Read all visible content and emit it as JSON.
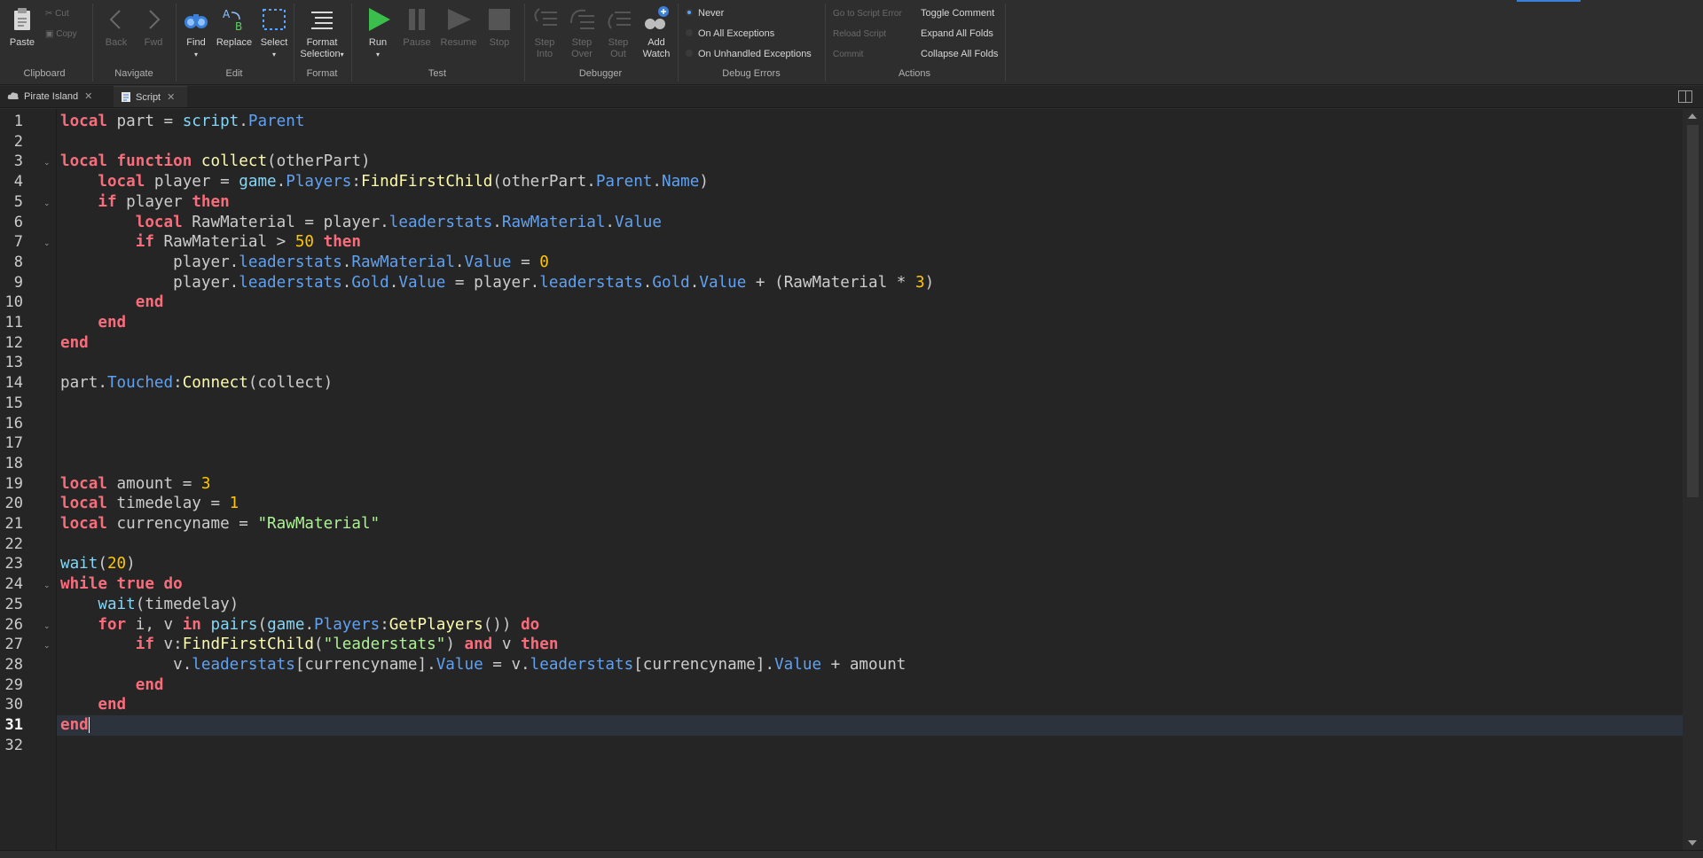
{
  "ribbon": {
    "clipboard": {
      "label": "Clipboard",
      "paste": "Paste",
      "cut": "Cut",
      "copy": "Copy"
    },
    "navigate": {
      "label": "Navigate",
      "back": "Back",
      "fwd": "Fwd"
    },
    "edit": {
      "label": "Edit",
      "find": "Find",
      "replace": "Replace",
      "select": "Select"
    },
    "format": {
      "label": "Format",
      "format_line1": "Format",
      "format_line2": "Selection"
    },
    "test": {
      "label": "Test",
      "run": "Run",
      "pause": "Pause",
      "resume": "Resume",
      "stop": "Stop"
    },
    "debugger": {
      "label": "Debugger",
      "step_into_1": "Step",
      "step_into_2": "Into",
      "step_over_1": "Step",
      "step_over_2": "Over",
      "step_out_1": "Step",
      "step_out_2": "Out",
      "add_watch_1": "Add",
      "add_watch_2": "Watch"
    },
    "debug_errors": {
      "label": "Debug Errors",
      "options": [
        "Never",
        "On All Exceptions",
        "On Unhandled Exceptions"
      ],
      "selected": "Never"
    },
    "actions": {
      "label": "Actions",
      "go_to_error": "Go to Script Error",
      "reload": "Reload Script",
      "commit": "Commit",
      "toggle_comment": "Toggle Comment",
      "expand": "Expand All Folds",
      "collapse": "Collapse All Folds"
    }
  },
  "tabs": [
    {
      "label": "Pirate Island",
      "icon": "cloud-icon",
      "active": false
    },
    {
      "label": "Script",
      "icon": "script-icon",
      "active": true
    }
  ],
  "editor": {
    "current_line": 31,
    "colors": {
      "keyword": "#f86d7c",
      "builtin": "#84d6f7",
      "property": "#61a1f1",
      "function": "#fdfbac",
      "number": "#ffc600",
      "string": "#adf195"
    },
    "lines": [
      [
        [
          "kw",
          "local"
        ],
        [
          "op",
          " part = "
        ],
        [
          "bi",
          "script"
        ],
        [
          "op",
          "."
        ],
        [
          "pr",
          "Parent"
        ]
      ],
      [],
      [
        [
          "kw",
          "local function"
        ],
        [
          "op",
          " "
        ],
        [
          "fn",
          "collect"
        ],
        [
          "op",
          "(otherPart)"
        ]
      ],
      [
        [
          "op",
          "    "
        ],
        [
          "kw",
          "local"
        ],
        [
          "op",
          " player = "
        ],
        [
          "bi",
          "game"
        ],
        [
          "op",
          "."
        ],
        [
          "pr",
          "Players"
        ],
        [
          "op",
          ":"
        ],
        [
          "fn",
          "FindFirstChild"
        ],
        [
          "op",
          "(otherPart."
        ],
        [
          "pr",
          "Parent"
        ],
        [
          "op",
          "."
        ],
        [
          "pr",
          "Name"
        ],
        [
          "op",
          ")"
        ]
      ],
      [
        [
          "op",
          "    "
        ],
        [
          "kw",
          "if"
        ],
        [
          "op",
          " player "
        ],
        [
          "kw",
          "then"
        ]
      ],
      [
        [
          "op",
          "        "
        ],
        [
          "kw",
          "local"
        ],
        [
          "op",
          " RawMaterial = player."
        ],
        [
          "pr",
          "leaderstats"
        ],
        [
          "op",
          "."
        ],
        [
          "pr",
          "RawMaterial"
        ],
        [
          "op",
          "."
        ],
        [
          "pr",
          "Value"
        ]
      ],
      [
        [
          "op",
          "        "
        ],
        [
          "kw",
          "if"
        ],
        [
          "op",
          " RawMaterial > "
        ],
        [
          "num",
          "50"
        ],
        [
          "op",
          " "
        ],
        [
          "kw",
          "then"
        ]
      ],
      [
        [
          "op",
          "            player."
        ],
        [
          "pr",
          "leaderstats"
        ],
        [
          "op",
          "."
        ],
        [
          "pr",
          "RawMaterial"
        ],
        [
          "op",
          "."
        ],
        [
          "pr",
          "Value"
        ],
        [
          "op",
          " = "
        ],
        [
          "num",
          "0"
        ]
      ],
      [
        [
          "op",
          "            player."
        ],
        [
          "pr",
          "leaderstats"
        ],
        [
          "op",
          "."
        ],
        [
          "pr",
          "Gold"
        ],
        [
          "op",
          "."
        ],
        [
          "pr",
          "Value"
        ],
        [
          "op",
          " = player."
        ],
        [
          "pr",
          "leaderstats"
        ],
        [
          "op",
          "."
        ],
        [
          "pr",
          "Gold"
        ],
        [
          "op",
          "."
        ],
        [
          "pr",
          "Value"
        ],
        [
          "op",
          " + (RawMaterial * "
        ],
        [
          "num",
          "3"
        ],
        [
          "op",
          ")"
        ]
      ],
      [
        [
          "op",
          "        "
        ],
        [
          "kw",
          "end"
        ]
      ],
      [
        [
          "op",
          "    "
        ],
        [
          "kw",
          "end"
        ]
      ],
      [
        [
          "kw",
          "end"
        ]
      ],
      [],
      [
        [
          "op",
          "part."
        ],
        [
          "pr",
          "Touched"
        ],
        [
          "op",
          ":"
        ],
        [
          "fn",
          "Connect"
        ],
        [
          "op",
          "(collect)"
        ]
      ],
      [],
      [],
      [],
      [],
      [
        [
          "kw",
          "local"
        ],
        [
          "op",
          " amount = "
        ],
        [
          "num",
          "3"
        ]
      ],
      [
        [
          "kw",
          "local"
        ],
        [
          "op",
          " timedelay = "
        ],
        [
          "num",
          "1"
        ]
      ],
      [
        [
          "kw",
          "local"
        ],
        [
          "op",
          " currencyname = "
        ],
        [
          "str",
          "\"RawMaterial\""
        ]
      ],
      [],
      [
        [
          "bi",
          "wait"
        ],
        [
          "op",
          "("
        ],
        [
          "num",
          "20"
        ],
        [
          "op",
          ")"
        ]
      ],
      [
        [
          "kw",
          "while true do"
        ]
      ],
      [
        [
          "op",
          "    "
        ],
        [
          "bi",
          "wait"
        ],
        [
          "op",
          "(timedelay)"
        ]
      ],
      [
        [
          "op",
          "    "
        ],
        [
          "kw",
          "for"
        ],
        [
          "op",
          " i, v "
        ],
        [
          "kw",
          "in"
        ],
        [
          "op",
          " "
        ],
        [
          "bi",
          "pairs"
        ],
        [
          "op",
          "("
        ],
        [
          "bi",
          "game"
        ],
        [
          "op",
          "."
        ],
        [
          "pr",
          "Players"
        ],
        [
          "op",
          ":"
        ],
        [
          "fn",
          "GetPlayers"
        ],
        [
          "op",
          "()) "
        ],
        [
          "kw",
          "do"
        ]
      ],
      [
        [
          "op",
          "        "
        ],
        [
          "kw",
          "if"
        ],
        [
          "op",
          " v:"
        ],
        [
          "fn",
          "FindFirstChild"
        ],
        [
          "op",
          "("
        ],
        [
          "str",
          "\"leaderstats\""
        ],
        [
          "op",
          ") "
        ],
        [
          "kw",
          "and"
        ],
        [
          "op",
          " v "
        ],
        [
          "kw",
          "then"
        ]
      ],
      [
        [
          "op",
          "            v."
        ],
        [
          "pr",
          "leaderstats"
        ],
        [
          "op",
          "[currencyname]."
        ],
        [
          "pr",
          "Value"
        ],
        [
          "op",
          " = v."
        ],
        [
          "pr",
          "leaderstats"
        ],
        [
          "op",
          "[currencyname]."
        ],
        [
          "pr",
          "Value"
        ],
        [
          "op",
          " + amount"
        ]
      ],
      [
        [
          "op",
          "        "
        ],
        [
          "kw",
          "end"
        ]
      ],
      [
        [
          "op",
          "    "
        ],
        [
          "kw",
          "end"
        ]
      ],
      [
        [
          "kw",
          "end"
        ]
      ],
      []
    ],
    "fold_lines": [
      3,
      5,
      7,
      24,
      26,
      27
    ]
  }
}
